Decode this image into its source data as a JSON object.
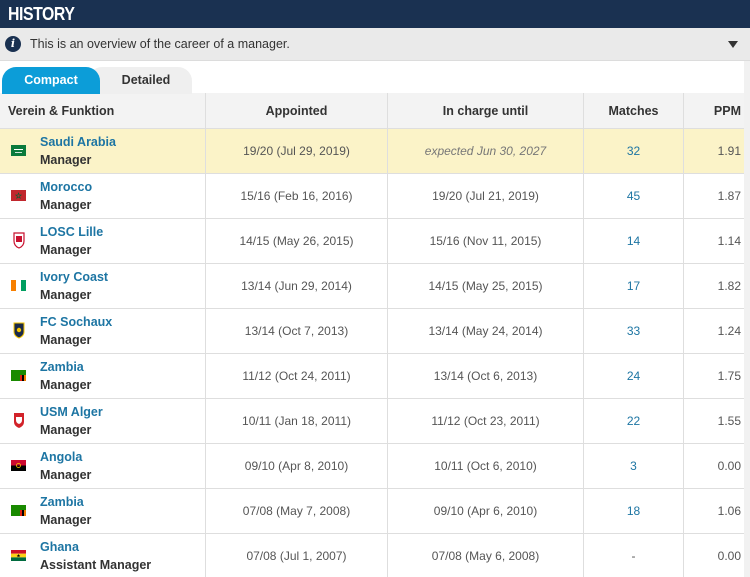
{
  "header": {
    "title": "HISTORY"
  },
  "info": {
    "icon": "info-icon",
    "text": "This is an overview of the career of a manager."
  },
  "tabs": [
    {
      "label": "Compact",
      "active": true
    },
    {
      "label": "Detailed",
      "active": false
    }
  ],
  "table": {
    "columns": [
      "Verein & Funktion",
      "Appointed",
      "In charge until",
      "Matches",
      "PPM"
    ],
    "rows": [
      {
        "club": "Saudi Arabia",
        "role": "Manager",
        "appointed": "19/20 (Jul 29, 2019)",
        "until": "expected Jun 30, 2027",
        "matches": "32",
        "ppm": "1.91",
        "icon": "saudi-arabia-flag"
      },
      {
        "club": "Morocco",
        "role": "Manager",
        "appointed": "15/16 (Feb 16, 2016)",
        "until": "19/20 (Jul 21, 2019)",
        "matches": "45",
        "ppm": "1.87",
        "icon": "morocco-flag"
      },
      {
        "club": "LOSC Lille",
        "role": "Manager",
        "appointed": "14/15 (May 26, 2015)",
        "until": "15/16 (Nov 11, 2015)",
        "matches": "14",
        "ppm": "1.14",
        "icon": "losc-lille-crest"
      },
      {
        "club": "Ivory Coast",
        "role": "Manager",
        "appointed": "13/14 (Jun 29, 2014)",
        "until": "14/15 (May 25, 2015)",
        "matches": "17",
        "ppm": "1.82",
        "icon": "ivory-coast-flag"
      },
      {
        "club": "FC Sochaux",
        "role": "Manager",
        "appointed": "13/14 (Oct 7, 2013)",
        "until": "13/14 (May 24, 2014)",
        "matches": "33",
        "ppm": "1.24",
        "icon": "fc-sochaux-crest"
      },
      {
        "club": "Zambia",
        "role": "Manager",
        "appointed": "11/12 (Oct 24, 2011)",
        "until": "13/14 (Oct 6, 2013)",
        "matches": "24",
        "ppm": "1.75",
        "icon": "zambia-flag"
      },
      {
        "club": "USM Alger",
        "role": "Manager",
        "appointed": "10/11 (Jan 18, 2011)",
        "until": "11/12 (Oct 23, 2011)",
        "matches": "22",
        "ppm": "1.55",
        "icon": "usm-alger-crest"
      },
      {
        "club": "Angola",
        "role": "Manager",
        "appointed": "09/10 (Apr 8, 2010)",
        "until": "10/11 (Oct 6, 2010)",
        "matches": "3",
        "ppm": "0.00",
        "icon": "angola-flag"
      },
      {
        "club": "Zambia",
        "role": "Manager",
        "appointed": "07/08 (May 7, 2008)",
        "until": "09/10 (Apr 6, 2010)",
        "matches": "18",
        "ppm": "1.06",
        "icon": "zambia-flag"
      },
      {
        "club": "Ghana",
        "role": "Assistant Manager",
        "appointed": "07/08 (Jul 1, 2007)",
        "until": "07/08 (May 6, 2008)",
        "matches": "-",
        "ppm": "0.00",
        "icon": "ghana-flag"
      }
    ]
  },
  "colors": {
    "header_bg": "#1a3151",
    "active_tab": "#0c9dd8",
    "link": "#1d75a3",
    "highlight_row": "#fbf3c8"
  }
}
